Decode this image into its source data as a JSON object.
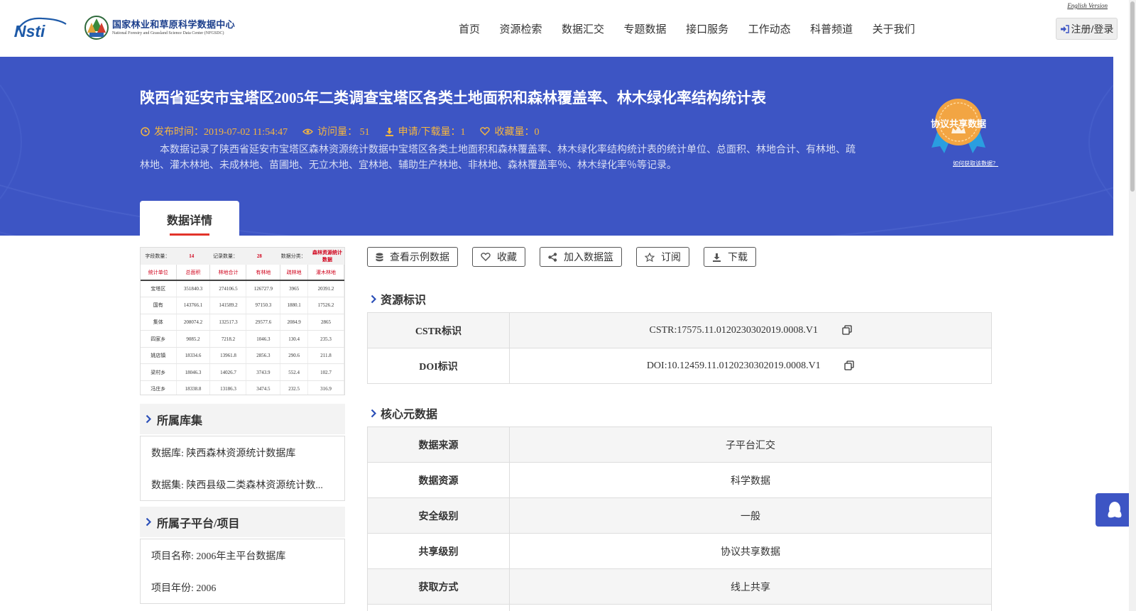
{
  "header": {
    "logo_nsti": "Nsti",
    "logo_cn": "国家林业和草原科学数据中心",
    "logo_en": "National Forestry and Grassland Science Data Center (NFGSDC)",
    "english_version": "English Version",
    "nav": [
      "首页",
      "资源检索",
      "数据汇交",
      "专题数据",
      "接口服务",
      "工作动态",
      "科普频道",
      "关于我们"
    ],
    "login": "注册/登录"
  },
  "banner": {
    "title": "陕西省延安市宝塔区2005年二类调查宝塔区各类土地面积和森林覆盖率、林木绿化率结构统计表",
    "publish_time": "发布时间：2019-07-02 11:54:47",
    "visits": "访问量： 51",
    "downloads": "申请/下载量：1",
    "favorites": "收藏量：0",
    "description": "本数据记录了陕西省延安市宝塔区森林资源统计数据中宝塔区各类土地面积和森林覆盖率、林木绿化率结构统计表的统计单位、总面积、林地合计、有林地、疏林地、灌木林地、未成林地、苗圃地、无立木地、宜林地、辅助生产林地、非林地、森林覆盖率％、林木绿化率％等记录。",
    "badge_label": "协议共享数据",
    "badge_help": "如何获取该数据？",
    "tab": "数据详情"
  },
  "thumbnail": {
    "top": [
      "字段数量：",
      "14",
      "记录数量：",
      "28",
      "数据分类：",
      "森林资源统计数据"
    ],
    "headers": [
      "统计单位",
      "总面积",
      "林地合计",
      "有林地",
      "疏林地",
      "灌木林地"
    ],
    "rows": [
      [
        "宝塔区",
        "351840.3",
        "274106.5",
        "126727.9",
        "3965",
        "20391.2"
      ],
      [
        "国有",
        "143766.1",
        "141589.2",
        "97150.3",
        "1880.1",
        "17526.2"
      ],
      [
        "集体",
        "208074.2",
        "132517.3",
        "29577.6",
        "2084.9",
        "2865"
      ],
      [
        "四家乡",
        "9085.2",
        "7218.2",
        "1046.3",
        "130.4",
        "235.3"
      ],
      [
        "姚店镇",
        "18334.6",
        "13961.8",
        "2856.3",
        "290.6",
        "211.8"
      ],
      [
        "梁村乡",
        "18046.3",
        "14026.7",
        "3743.9",
        "552.4",
        "102.7"
      ],
      [
        "冯庄乡",
        "18338.8",
        "13186.3",
        "3474.5",
        "232.5",
        "316.9"
      ]
    ]
  },
  "library": {
    "heading": "所属库集",
    "database": "数据库: 陕西森林资源统计数据库",
    "dataset": "数据集: 陕西县级二类森林资源统计数..."
  },
  "platform": {
    "heading": "所属子平台/项目",
    "project_name": "项目名称: 2006年主平台数据库",
    "project_year": "项目年份: 2006"
  },
  "actions": {
    "sample": "查看示例数据",
    "favorite": "收藏",
    "add_basket": "加入数据篮",
    "subscribe": "订阅",
    "download": "下载"
  },
  "identifiers": {
    "heading": "资源标识",
    "cstr_label": "CSTR标识",
    "cstr_value": "CSTR:17575.11.0120230302019.0008.V1",
    "doi_label": "DOI标识",
    "doi_value": "DOI:10.12459.11.0120230302019.0008.V1"
  },
  "core_meta": {
    "heading": "核心元数据",
    "rows": [
      {
        "key": "数据来源",
        "value": "子平台汇交"
      },
      {
        "key": "数据资源",
        "value": "科学数据"
      },
      {
        "key": "安全级别",
        "value": "一般"
      },
      {
        "key": "共享级别",
        "value": "协议共享数据"
      },
      {
        "key": "获取方式",
        "value": "线上共享"
      }
    ]
  },
  "colors": {
    "banner": "#3d55c4",
    "accent_orange": "#f5b640",
    "tab_underline": "#e2332a",
    "nsti_blue": "#1e5aa8"
  }
}
